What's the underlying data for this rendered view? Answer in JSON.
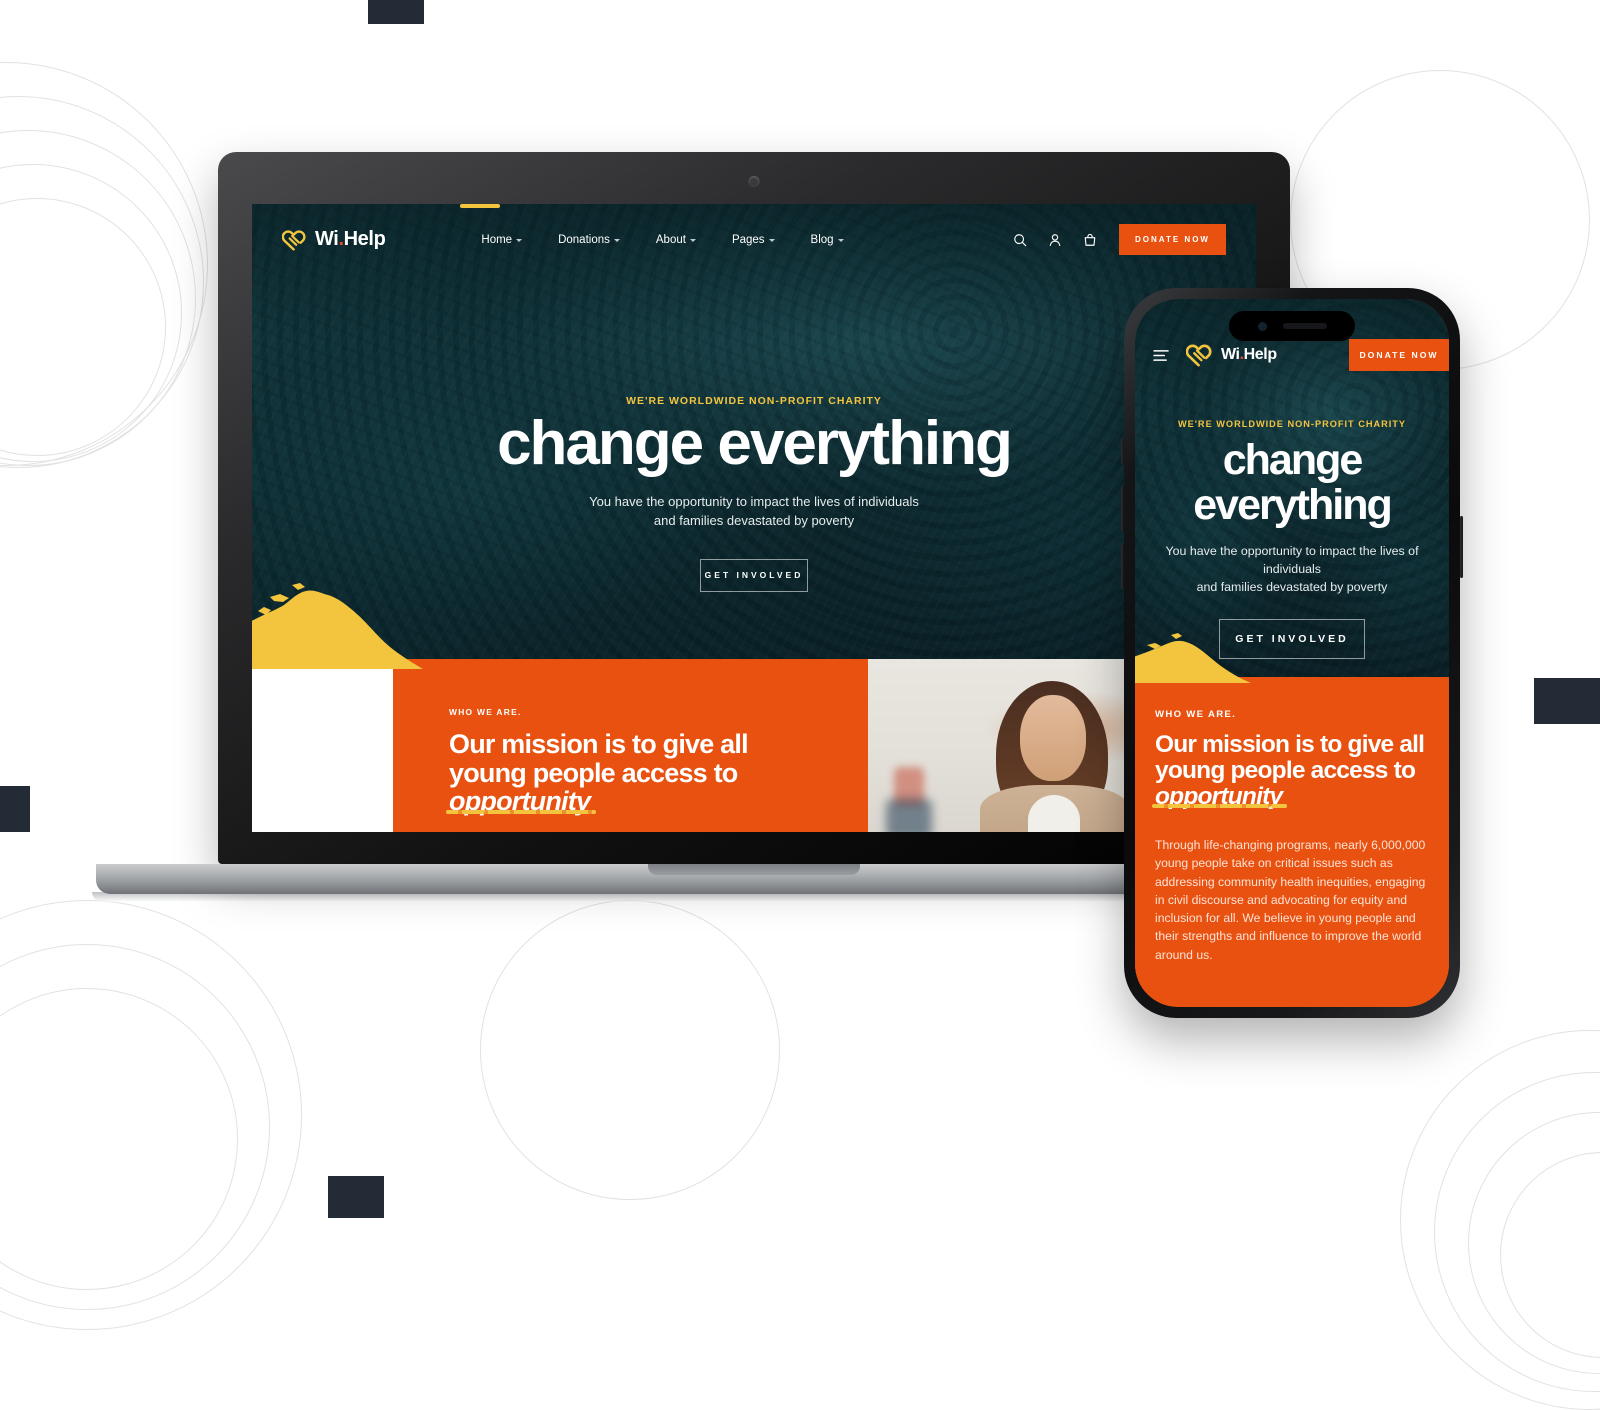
{
  "page": {
    "background": "#ffffff",
    "accent_orange": "#e8510f",
    "accent_yellow": "#f3c53f",
    "dark_navy": "#232b37",
    "teal": "#0f343b"
  },
  "desktop": {
    "brand": {
      "name_first": "Wi",
      "dot": ".",
      "name_second": "Help",
      "icon": "heart-ribbon-icon"
    },
    "nav_items": [
      {
        "label": "Home",
        "has_caret": true,
        "active": true
      },
      {
        "label": "Donations",
        "has_caret": true,
        "active": false
      },
      {
        "label": "About",
        "has_caret": true,
        "active": false
      },
      {
        "label": "Pages",
        "has_caret": true,
        "active": false
      },
      {
        "label": "Blog",
        "has_caret": true,
        "active": false
      }
    ],
    "nav_icons": [
      "search-icon",
      "user-icon",
      "cart-icon"
    ],
    "donate_label": "DONATE NOW",
    "hero": {
      "eyebrow": "WE'RE WORLDWIDE NON-PROFIT CHARITY",
      "heading": "change everything",
      "subtitle_line1": "You have the opportunity to impact the lives of individuals",
      "subtitle_line2": "and families devastated by poverty",
      "cta_label": "GET INVOLVED"
    },
    "mission": {
      "eyebrow": "WHO WE ARE.",
      "line1": "Our mission is to give all",
      "line2": "young people access to",
      "emphasis": "opportunity"
    }
  },
  "mobile": {
    "brand": {
      "name_first": "Wi",
      "dot": ".",
      "name_second": "Help",
      "icon": "heart-ribbon-icon"
    },
    "menu_icon": "hamburger-icon",
    "donate_label": "DONATE NOW",
    "hero": {
      "eyebrow": "WE'RE WORLDWIDE NON-PROFIT CHARITY",
      "heading_line1": "change",
      "heading_line2": "everything",
      "subtitle_line1": "You have the opportunity to impact the lives of",
      "subtitle_line2": "individuals",
      "subtitle_line3": "and families devastated by poverty",
      "cta_label": "GET INVOLVED"
    },
    "mission": {
      "eyebrow": "WHO WE ARE.",
      "line1": "Our mission is to give all",
      "line2": "young people access to",
      "emphasis": "opportunity",
      "body": "Through life-changing programs, nearly 6,000,000 young people take on critical issues such as addressing community health inequities, engaging in civil discourse and advocating for equity and inclusion for all. We believe in young people and their strengths and influence to improve the world around us."
    }
  }
}
